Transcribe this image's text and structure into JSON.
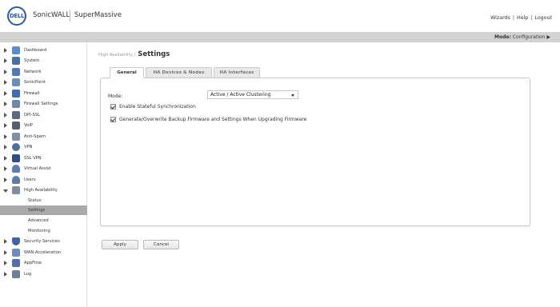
{
  "header": {
    "logo_text": "DELL",
    "brand_primary": "SonicWALL",
    "brand_product": "SuperMassive",
    "links": [
      "Wizards",
      "Help",
      "Logout"
    ]
  },
  "modebar": {
    "mode_label": "Mode:",
    "mode_value": "Configuration ▶"
  },
  "sidebar": {
    "items": [
      {
        "label": "Dashboard",
        "icon": "dashboard-icon",
        "color": "#5b8bd1"
      },
      {
        "label": "System",
        "icon": "monitor-icon",
        "color": "#4a6fa8"
      },
      {
        "label": "Network",
        "icon": "network-icon",
        "color": "#4d79b8"
      },
      {
        "label": "SonicPoint",
        "icon": "access-point-icon",
        "color": "#6b8fb8"
      },
      {
        "label": "Firewall",
        "icon": "firewall-icon",
        "color": "#3f6db0"
      },
      {
        "label": "Firewall Settings",
        "icon": "firewall-settings-icon",
        "color": "#6a8ab0"
      },
      {
        "label": "DPI-SSL",
        "icon": "lock-icon",
        "color": "#5a6a80"
      },
      {
        "label": "VoIP",
        "icon": "phone-icon",
        "color": "#555e6a"
      },
      {
        "label": "Anti-Spam",
        "icon": "mail-icon",
        "color": "#7b8fa8"
      },
      {
        "label": "VPN",
        "icon": "globe-icon",
        "color": "#4d6fa0"
      },
      {
        "label": "SSL VPN",
        "icon": "ssl-vpn-icon",
        "color": "#2f4f8a"
      },
      {
        "label": "Virtual Assist",
        "icon": "person-icon",
        "color": "#5a7fb0"
      },
      {
        "label": "Users",
        "icon": "users-icon",
        "color": "#5c7da8"
      },
      {
        "label": "High Availability",
        "icon": "server-icon",
        "color": "#7d8ea3"
      }
    ],
    "sub_items": [
      "Status",
      "Settings",
      "Advanced",
      "Monitoring"
    ],
    "items_after": [
      {
        "label": "Security Services",
        "icon": "shield-icon",
        "color": "#3d63a8"
      },
      {
        "label": "WAN Acceleration",
        "icon": "wan-icon",
        "color": "#6a8cbf"
      },
      {
        "label": "AppFlow",
        "icon": "appflow-icon",
        "color": "#4f72aa"
      },
      {
        "label": "Log",
        "icon": "log-icon",
        "color": "#6d7f96"
      }
    ]
  },
  "breadcrumb": {
    "parent": "High Availability /",
    "current": "Settings"
  },
  "tabs": [
    "General",
    "HA Devices & Nodes",
    "HA Interfaces"
  ],
  "form": {
    "mode_label": "Mode:",
    "mode_value": "Active / Active Clustering",
    "checkbox_1": "Enable Stateful Synchronization",
    "checkbox_2": "Generate/Overwrite Backup Firmware and Settings When Upgrading Firmware"
  },
  "buttons": {
    "apply": "Apply",
    "cancel": "Cancel"
  }
}
